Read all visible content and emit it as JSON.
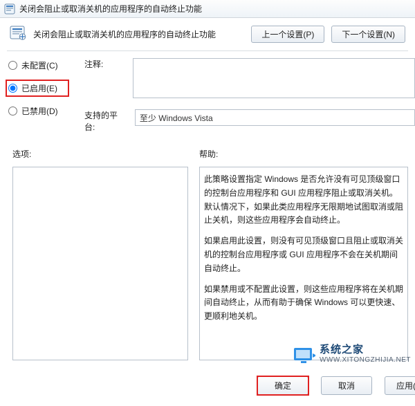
{
  "window": {
    "title": "关闭会阻止或取消关机的应用程序的自动终止功能"
  },
  "header": {
    "policy_title": "关闭会阻止或取消关机的应用程序的自动终止功能",
    "prev_btn": "上一个设置(P)",
    "next_btn": "下一个设置(N)"
  },
  "radios": {
    "not_configured": "未配置(C)",
    "enabled": "已启用(E)",
    "disabled": "已禁用(D)",
    "selected": "enabled"
  },
  "labels": {
    "comment": "注释:",
    "supported": "支持的平台:",
    "options": "选项:",
    "help": "帮助:"
  },
  "fields": {
    "comment_value": "",
    "supported_value": "至少 Windows Vista"
  },
  "help": {
    "p1": "此策略设置指定 Windows 是否允许没有可见顶级窗口的控制台应用程序和 GUI 应用程序阻止或取消关机。默认情况下，如果此类应用程序无限期地试图取消或阻止关机，则这些应用程序会自动终止。",
    "p2": "如果启用此设置，则没有可见顶级窗口且阻止或取消关机的控制台应用程序或 GUI 应用程序不会在关机期间自动终止。",
    "p3": "如果禁用或不配置此设置，则这些应用程序将在关机期间自动终止，从而有助于确保 Windows 可以更快速、更顺利地关机。"
  },
  "footer": {
    "ok": "确定",
    "cancel": "取消",
    "apply": "应用(A)"
  },
  "watermark": {
    "cn": "系统之家",
    "url": "WWW.XITONGZHIJIA.NET"
  }
}
